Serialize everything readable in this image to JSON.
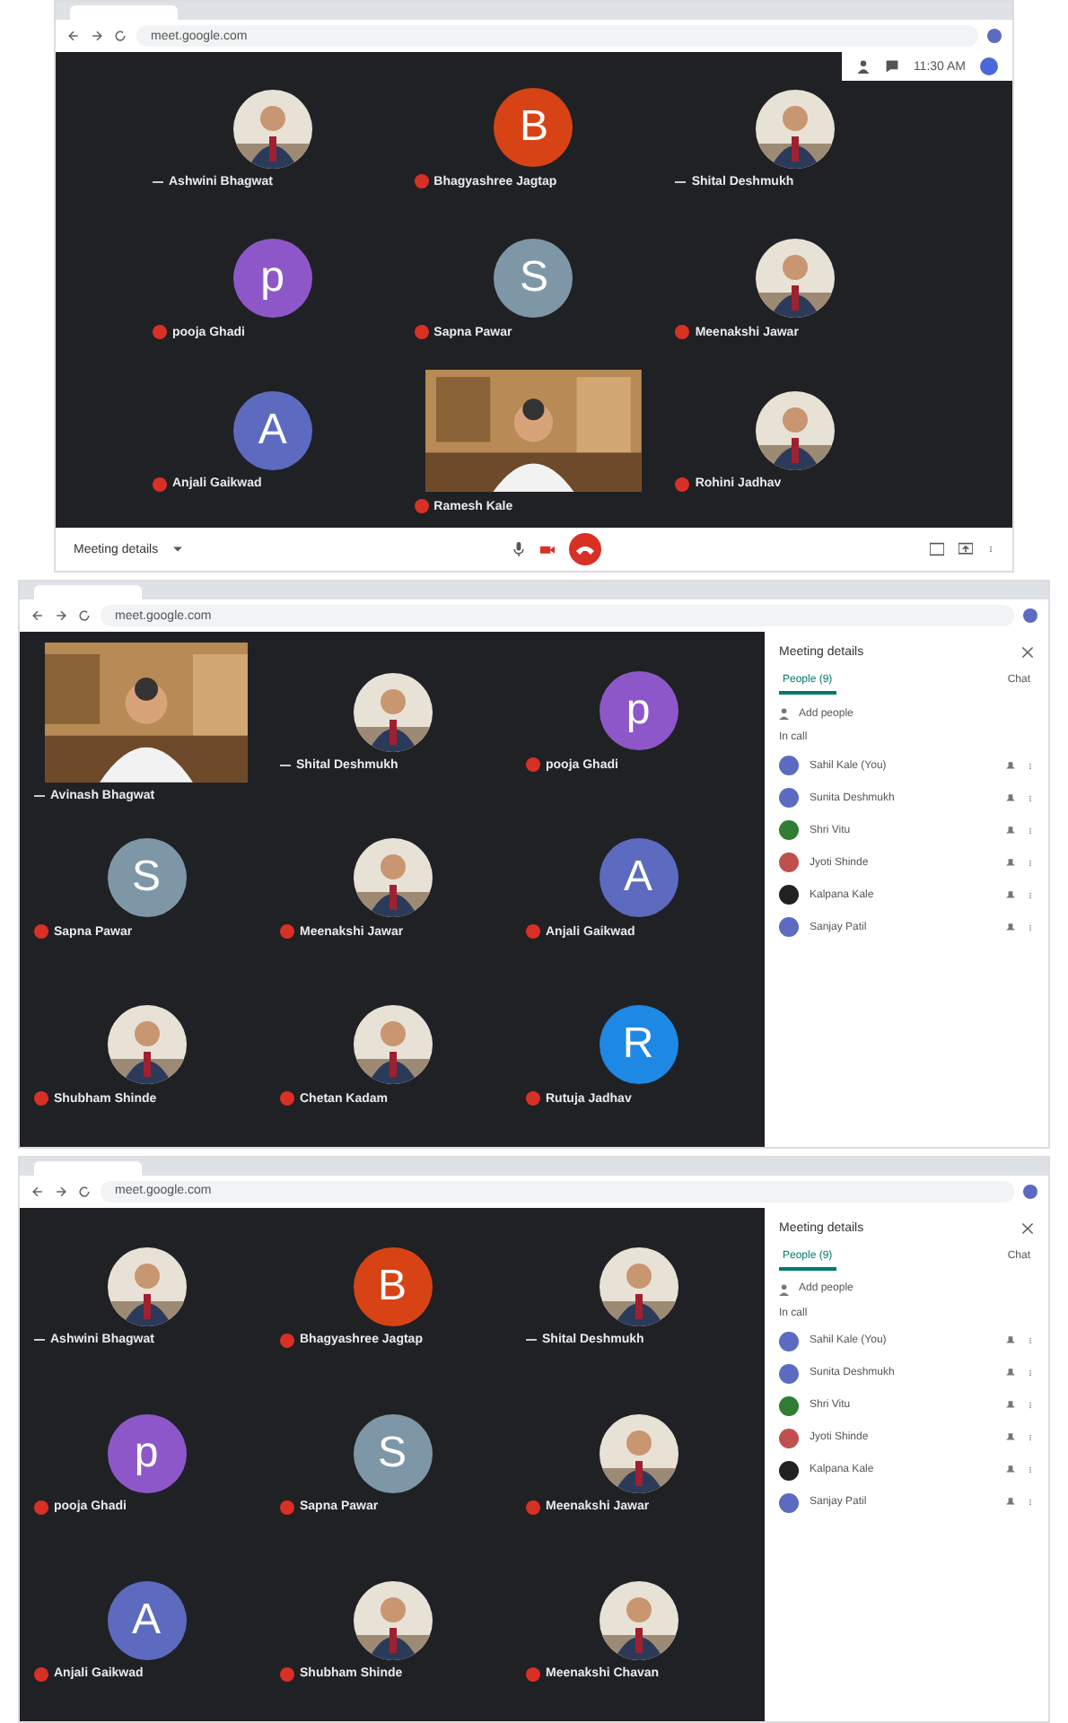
{
  "screens": [
    {
      "url": "meet.google.com",
      "time": "11:30 AM",
      "bottom_bar": {
        "label": "Meeting details"
      },
      "tiles": [
        {
          "name": "Ashwini Bhagwat",
          "muted": false
        },
        {
          "kind": "letter",
          "letter": "B",
          "color": "#d84315",
          "name": "Bhagyashree Jagtap",
          "muted": true
        },
        {
          "name": "Shital Deshmukh",
          "muted": false
        },
        {
          "kind": "letter",
          "letter": "p",
          "color": "#8e57c9",
          "name": "pooja Ghadi",
          "muted": true
        },
        {
          "kind": "letter",
          "letter": "S",
          "color": "#7e97a6",
          "name": "Sapna Pawar",
          "muted": true
        },
        {
          "name": "Meenakshi Jawar",
          "muted": true
        },
        {
          "kind": "letter",
          "letter": "A",
          "color": "#5c6bc0",
          "name": "Anjali Gaikwad",
          "muted": true
        },
        {
          "kind": "video",
          "name": "Ramesh Kale",
          "muted": true
        },
        {
          "name": "Rohini Jadhav",
          "muted": true
        }
      ]
    },
    {
      "url": "meet.google.com",
      "tiles": [
        {
          "kind": "video",
          "name": "Avinash Bhagwat",
          "muted": false
        },
        {
          "name": "Shital Deshmukh",
          "muted": false
        },
        {
          "kind": "letter",
          "letter": "p",
          "color": "#8e57c9",
          "name": "pooja Ghadi",
          "muted": true
        },
        {
          "kind": "letter",
          "letter": "S",
          "color": "#7e97a6",
          "name": "Sapna Pawar",
          "muted": true
        },
        {
          "name": "Meenakshi Jawar",
          "muted": true
        },
        {
          "kind": "letter",
          "letter": "A",
          "color": "#5c6bc0",
          "name": "Anjali Gaikwad",
          "muted": true
        },
        {
          "name": "Shubham Shinde",
          "muted": true
        },
        {
          "name": "Chetan Kadam",
          "muted": true
        },
        {
          "kind": "letter",
          "letter": "R",
          "color": "#1e88e5",
          "name": "Rutuja Jadhav",
          "muted": true
        }
      ],
      "side_panel": {
        "title": "Meeting details",
        "tabs": [
          {
            "label": "People (9)",
            "selected": true
          },
          {
            "label": "Chat",
            "selected": false
          }
        ],
        "add_label": "Add people",
        "section": "In call",
        "people": [
          {
            "name": "Sahil Kale (You)",
            "color": "#5c6bc0"
          },
          {
            "name": "Sunita Deshmukh",
            "color": "#5c6bc0"
          },
          {
            "name": "Shri Vitu",
            "color": "#2e7d32"
          },
          {
            "name": "Jyoti Shinde",
            "color": "#c0504d"
          },
          {
            "name": "Kalpana Kale",
            "color": "#212121"
          },
          {
            "name": "Sanjay Patil",
            "color": "#5c6bc0"
          }
        ]
      }
    },
    {
      "url": "meet.google.com",
      "tiles": [
        {
          "name": "Ashwini Bhagwat",
          "muted": false
        },
        {
          "kind": "letter",
          "letter": "B",
          "color": "#d84315",
          "name": "Bhagyashree Jagtap",
          "muted": true
        },
        {
          "name": "Shital Deshmukh",
          "muted": false
        },
        {
          "kind": "letter",
          "letter": "p",
          "color": "#8e57c9",
          "name": "pooja Ghadi",
          "muted": true
        },
        {
          "kind": "letter",
          "letter": "S",
          "color": "#7e97a6",
          "name": "Sapna Pawar",
          "muted": true
        },
        {
          "name": "Meenakshi Jawar",
          "muted": true
        },
        {
          "kind": "letter",
          "letter": "A",
          "color": "#5c6bc0",
          "name": "Anjali Gaikwad",
          "muted": true
        },
        {
          "name": "Shubham Shinde",
          "muted": true
        },
        {
          "name": "Meenakshi Chavan",
          "muted": true
        }
      ],
      "side_panel": {
        "title": "Meeting details",
        "tabs": [
          {
            "label": "People (9)",
            "selected": true
          },
          {
            "label": "Chat",
            "selected": false
          }
        ],
        "add_label": "Add people",
        "section": "In call",
        "people": [
          {
            "name": "Sahil Kale (You)",
            "color": "#5c6bc0"
          },
          {
            "name": "Sunita Deshmukh",
            "color": "#5c6bc0"
          },
          {
            "name": "Shri Vitu",
            "color": "#2e7d32"
          },
          {
            "name": "Jyoti Shinde",
            "color": "#c0504d"
          },
          {
            "name": "Kalpana Kale",
            "color": "#212121"
          },
          {
            "name": "Sanjay Patil",
            "color": "#5c6bc0"
          }
        ]
      }
    }
  ]
}
